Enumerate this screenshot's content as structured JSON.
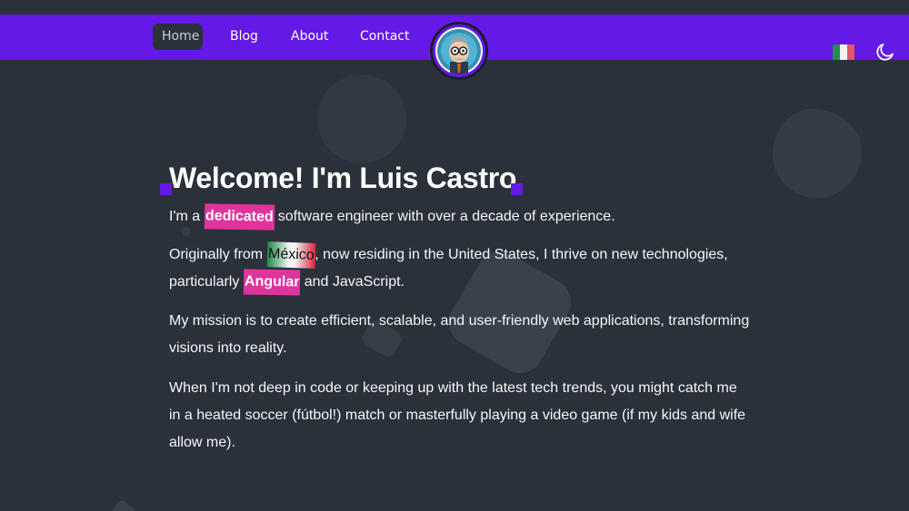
{
  "nav": {
    "links": [
      {
        "label": "Home",
        "active": true
      },
      {
        "label": "Blog",
        "active": false
      },
      {
        "label": "About",
        "active": false
      },
      {
        "label": "Contact",
        "active": false
      }
    ],
    "language_flag": "mexico-flag-icon",
    "theme_toggle": "moon-icon"
  },
  "hero": {
    "title": "Welcome! I'm Luis Castro",
    "p1_before": "I'm a ",
    "p1_highlight": "dedicated",
    "p1_after": " software engineer with over a decade of experience.",
    "p2_before": "Originally from ",
    "p2_highlight": "México",
    "p2_middle": ", now residing in the United States, I thrive on new technologies, particularly ",
    "p2_highlight2": "Angular",
    "p2_after": " and JavaScript.",
    "p3": "My mission is to create efficient, scalable, and user-friendly web applications, transforming visions into reality.",
    "p4": "When I'm not deep in code or keeping up with the latest tech trends, you might catch me in a heated soccer (fútbol!) match or masterfully playing a video game (if my kids and wife allow me)."
  },
  "colors": {
    "background": "#2b313a",
    "navbar": "#6419e6",
    "highlight": "#e0349c"
  }
}
